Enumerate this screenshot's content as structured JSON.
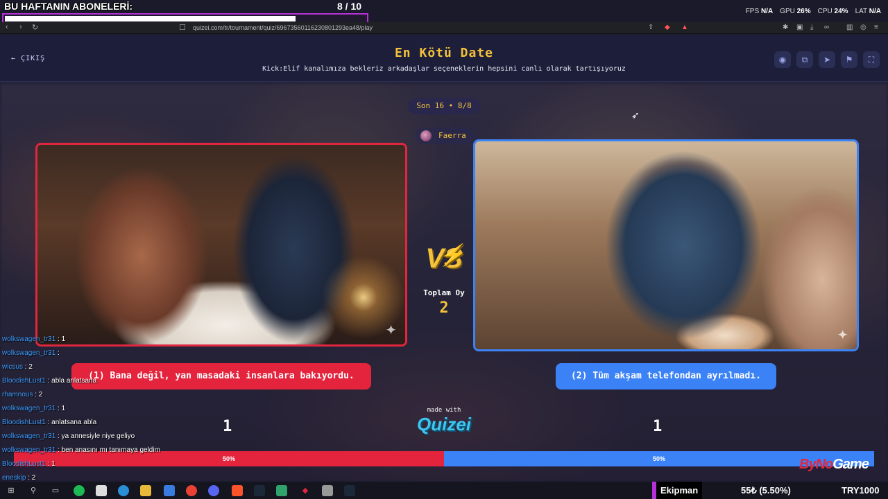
{
  "overlay": {
    "subs_title": "BU HAFTANIN ABONELERİ:",
    "subs_count": "8 / 10",
    "subs_progress": 0.8,
    "stats": [
      {
        "label": "FPS",
        "value": "N/A"
      },
      {
        "label": "GPU",
        "value": "26%"
      },
      {
        "label": "CPU",
        "value": "24%"
      },
      {
        "label": "LAT",
        "value": "N/A"
      }
    ]
  },
  "browser": {
    "url": "quizei.com/tr/tournament/quiz/69673560116230801293ea48/play"
  },
  "header": {
    "back_label": "ÇIKIŞ",
    "title": "En Kötü Date",
    "description": "Kick:Elif kanalımıza bekleriz arkadaşlar seçeneklerin hepsini canlı olarak tartışıyoruz"
  },
  "round": {
    "pill": "Son 16 • 8/8",
    "user": "Faerra"
  },
  "vs": {
    "label": "VS",
    "total_label": "Toplam Oy",
    "total_value": "2"
  },
  "options": [
    {
      "label": "(1) Bana değil, yan masadaki insanlara bakıyordu.",
      "score": "1",
      "percent": "50%",
      "fraction": 0.5,
      "color": "#e4243d"
    },
    {
      "label": "(2) Tüm akşam telefondan ayrılmadı.",
      "score": "1",
      "percent": "50%",
      "fraction": 0.5,
      "color": "#3b82f6"
    }
  ],
  "brand": {
    "made_with": "made with",
    "name": "Quizei"
  },
  "sponsor": {
    "name_a": "By",
    "name_b": "No",
    "name_c": "Game"
  },
  "chat": [
    {
      "user": "wolkswagen_tr31",
      "msg": ": 1"
    },
    {
      "user": "wolkswagen_tr31",
      "msg": ":"
    },
    {
      "user": "wicsus",
      "msg": ": 2"
    },
    {
      "user": "BloodishLust1",
      "msg": ": abla anlatsana"
    },
    {
      "user": "rhamnous",
      "msg": ": 2"
    },
    {
      "user": "wolkswagen_tr31",
      "msg": ": 1"
    },
    {
      "user": "BloodishLust1",
      "msg": ": anlatsana abla"
    },
    {
      "user": "wolkswagen_tr31",
      "msg": ": ya annesiyle niye geliyo"
    },
    {
      "user": "wolkswagen_tr31",
      "msg": ": ben anasını mı tanımaya geldim"
    },
    {
      "user": "BloodishLust1",
      "msg": ": 1"
    },
    {
      "user": "eneskip",
      "msg": ": 2"
    }
  ],
  "taskbar": {
    "ekipman": "Ekipman",
    "ticker": "55₺ (5.50%)",
    "currency": "TRY1000"
  }
}
